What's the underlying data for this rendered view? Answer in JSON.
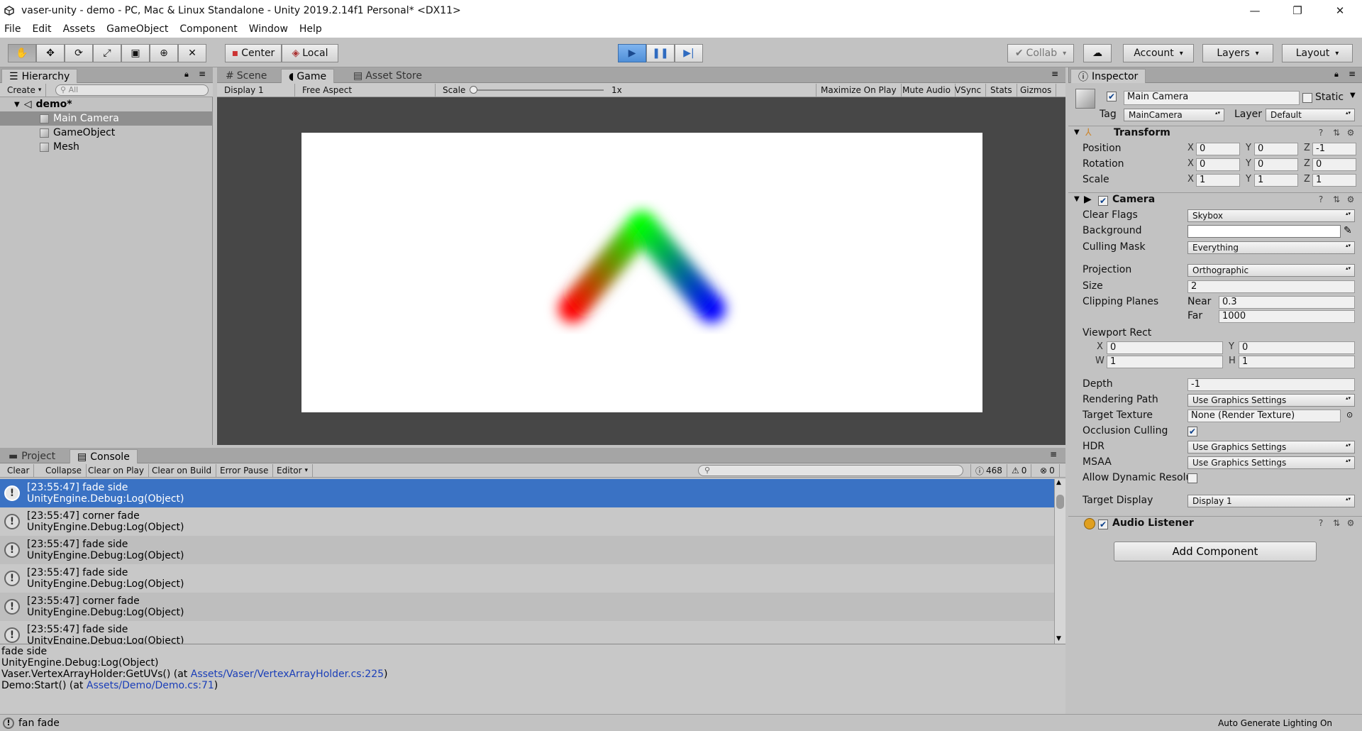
{
  "window": {
    "title": "vaser-unity - demo - PC, Mac & Linux Standalone - Unity 2019.2.14f1 Personal* <DX11>",
    "minimize": "—",
    "restore": "❐",
    "close": "✕"
  },
  "menu": [
    "File",
    "Edit",
    "Assets",
    "GameObject",
    "Component",
    "Window",
    "Help"
  ],
  "toolbar": {
    "pivot_label": "Center",
    "space_label": "Local",
    "collab_label": "Collab",
    "account_label": "Account",
    "layers_label": "Layers",
    "layout_label": "Layout"
  },
  "hierarchy": {
    "tab_label": "Hierarchy",
    "create_label": "Create",
    "search_placeholder": "All",
    "scene_name": "demo*",
    "items": [
      "Main Camera",
      "GameObject",
      "Mesh"
    ]
  },
  "scene_tabs": [
    "Scene",
    "Game",
    "Asset Store"
  ],
  "game_bar": {
    "display": "Display 1",
    "aspect": "Free Aspect",
    "scale_label": "Scale",
    "scale_value": "1x",
    "maximize": "Maximize On Play",
    "mute": "Mute Audio",
    "vsync": "VSync",
    "stats": "Stats",
    "gizmos": "Gizmos"
  },
  "bottom_tabs": [
    "Project",
    "Console"
  ],
  "console_bar": {
    "clear": "Clear",
    "collapse": "Collapse",
    "clear_on_play": "Clear on Play",
    "clear_on_build": "Clear on Build",
    "error_pause": "Error Pause",
    "editor": "Editor",
    "log_count": "468",
    "warn_count": "0",
    "error_count": "0"
  },
  "logs": [
    {
      "line1": "[23:55:47] fade side",
      "line2": "UnityEngine.Debug:Log(Object)"
    },
    {
      "line1": "[23:55:47] corner fade",
      "line2": "UnityEngine.Debug:Log(Object)"
    },
    {
      "line1": "[23:55:47] fade side",
      "line2": "UnityEngine.Debug:Log(Object)"
    },
    {
      "line1": "[23:55:47] fade side",
      "line2": "UnityEngine.Debug:Log(Object)"
    },
    {
      "line1": "[23:55:47] corner fade",
      "line2": "UnityEngine.Debug:Log(Object)"
    },
    {
      "line1": "[23:55:47] fade side",
      "line2": "UnityEngine.Debug:Log(Object)"
    }
  ],
  "detail": {
    "line1": "fade side",
    "line2": "UnityEngine.Debug:Log(Object)",
    "line3_prefix": "Vaser.VertexArrayHolder:GetUVs() (at ",
    "line3_link": "Assets/Vaser/VertexArrayHolder.cs:225",
    "line3_suffix": ")",
    "line4_prefix": "Demo:Start() (at ",
    "line4_link": "Assets/Demo/Demo.cs:71",
    "line4_suffix": ")"
  },
  "status": {
    "message": "fan fade",
    "right": "Auto Generate Lighting On"
  },
  "inspector": {
    "tab_label": "Inspector",
    "object_name": "Main Camera",
    "static_label": "Static",
    "tag_label": "Tag",
    "tag_value": "MainCamera",
    "layer_label": "Layer",
    "layer_value": "Default",
    "transform": {
      "title": "Transform",
      "position_label": "Position",
      "position": [
        "0",
        "0",
        "-1"
      ],
      "rotation_label": "Rotation",
      "rotation": [
        "0",
        "0",
        "0"
      ],
      "scale_label": "Scale",
      "scale": [
        "1",
        "1",
        "1"
      ]
    },
    "camera": {
      "title": "Camera",
      "clear_flags_label": "Clear Flags",
      "clear_flags": "Skybox",
      "background_label": "Background",
      "culling_mask_label": "Culling Mask",
      "culling_mask": "Everything",
      "projection_label": "Projection",
      "projection": "Orthographic",
      "size_label": "Size",
      "size": "2",
      "clipping_label": "Clipping Planes",
      "near_label": "Near",
      "near": "0.3",
      "far_label": "Far",
      "far": "1000",
      "viewport_label": "Viewport Rect",
      "vx": "0",
      "vy": "0",
      "vw": "1",
      "vh": "1",
      "depth_label": "Depth",
      "depth": "-1",
      "rendering_path_label": "Rendering Path",
      "rendering_path": "Use Graphics Settings",
      "target_texture_label": "Target Texture",
      "target_texture": "None (Render Texture)",
      "occlusion_label": "Occlusion Culling",
      "hdr_label": "HDR",
      "hdr": "Use Graphics Settings",
      "msaa_label": "MSAA",
      "msaa": "Use Graphics Settings",
      "dynamic_res_label": "Allow Dynamic Resolu",
      "target_display_label": "Target Display",
      "target_display": "Display 1"
    },
    "audio_listener": "Audio Listener",
    "add_component": "Add Component"
  }
}
